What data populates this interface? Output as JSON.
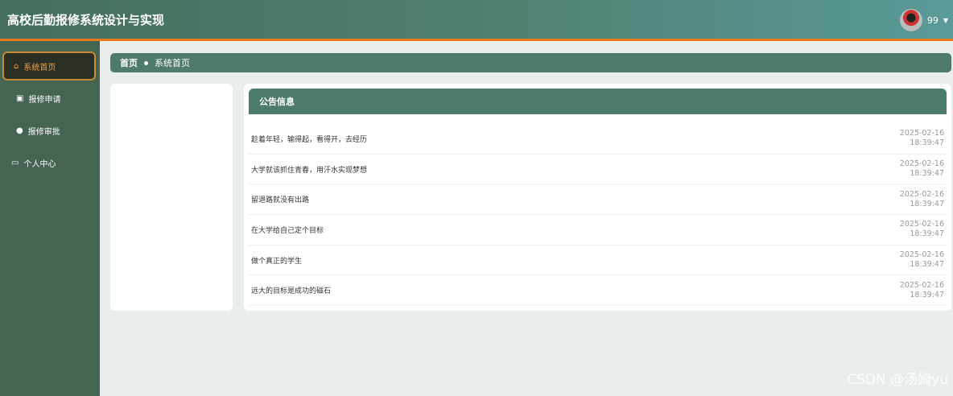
{
  "header": {
    "title": "高校后勤报修系统设计与实现",
    "username": "99"
  },
  "sidebar": {
    "items": [
      {
        "label": "系统首页",
        "icon": "home-icon"
      },
      {
        "label": "报修申请",
        "icon": "clipboard-icon"
      },
      {
        "label": "报修审批",
        "icon": "user-icon"
      },
      {
        "label": "个人中心",
        "icon": "card-icon"
      }
    ]
  },
  "breadcrumb": {
    "home": "首页",
    "current": "系统首页"
  },
  "notices": {
    "title": "公告信息",
    "items": [
      {
        "title": "趁着年轻，输得起，看得开，去经历",
        "date": "2025-02-16",
        "time": "18:39:47"
      },
      {
        "title": "大学就该抓住青春，用汗水实现梦想",
        "date": "2025-02-16",
        "time": "18:39:47"
      },
      {
        "title": "留退路就没有出路",
        "date": "2025-02-16",
        "time": "18:39:47"
      },
      {
        "title": "在大学给自己定个目标",
        "date": "2025-02-16",
        "time": "18:39:47"
      },
      {
        "title": "做个真正的学生",
        "date": "2025-02-16",
        "time": "18:39:47"
      },
      {
        "title": "远大的目标是成功的磁石",
        "date": "2025-02-16",
        "time": "18:39:47"
      }
    ]
  },
  "watermark": "CSDN @汤姆yu"
}
